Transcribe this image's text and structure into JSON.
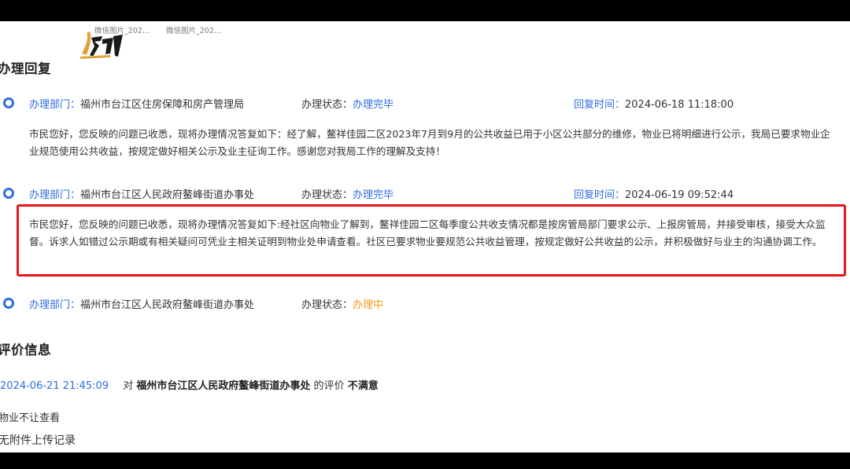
{
  "attachments": {
    "thumb1_name": "微信图片_202…",
    "thumb2_name": "微信图片_202…"
  },
  "handling": {
    "title": "办理回复",
    "dept_label": "办理部门：",
    "status_label": "办理状态：",
    "time_label": "回复时间：",
    "records": [
      {
        "dept": "福州市台江区住房保障和房产管理局",
        "status": "办理完毕",
        "time": "2024-06-18 11:18:00",
        "reply": "市民您好，您反映的问题已收悉，现将办理情况答复如下：经了解，鳌祥佳园二区2023年7月到9月的公共收益已用于小区公共部分的维修，物业已将明细进行公示，我局已要求物业企业规范使用公共收益，按规定做好相关公示及业主征询工作。感谢您对我局工作的理解及支持！"
      },
      {
        "dept": "福州市台江区人民政府鳌峰街道办事处",
        "status": "办理完毕",
        "time": "2024-06-19 09:52:44",
        "reply": "市民您好，您反映的问题已收悉，现将办理情况答复如下:经社区向物业了解到，鳌祥佳园二区每季度公共收支情况都是按房管局部门要求公示、上报房管局，并接受审核，接受大众监督。诉求人如错过公示期或有相关疑问可凭业主相关证明到物业处申请查看。社区已要求物业要规范公共收益管理，按规定做好公共收益的公示，并积极做好与业主的沟通协调工作。"
      },
      {
        "dept": "福州市台江区人民政府鳌峰街道办事处",
        "status": "办理中"
      }
    ]
  },
  "evaluation": {
    "title": "评价信息",
    "time": "2024-06-21 21:45:09",
    "pre": "对",
    "dept": "福州市台江区人民政府鳌峰街道办事处",
    "mid": "的评价",
    "result": "不满意",
    "comment": "物业不让查看",
    "attachment_note": "无附件上传记录"
  },
  "colors": {
    "link_blue": "#2f6de0",
    "in_progress": "#f29b1a",
    "highlight_red": "#e8141c"
  }
}
